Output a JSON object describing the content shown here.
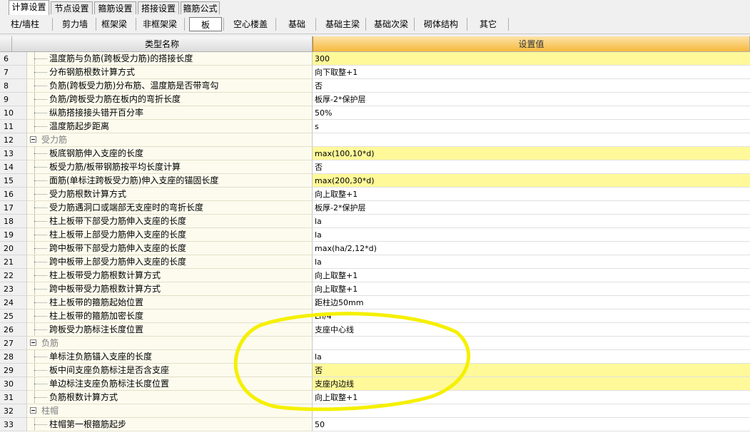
{
  "tabs": [
    {
      "label": "计算设置",
      "active": true
    },
    {
      "label": "节点设置",
      "active": false
    },
    {
      "label": "箍筋设置",
      "active": false
    },
    {
      "label": "搭接设置",
      "active": false
    },
    {
      "label": "箍筋公式",
      "active": false
    }
  ],
  "toolbar": [
    {
      "label": "柱/墙柱",
      "selected": false
    },
    {
      "label": "剪力墙",
      "selected": false
    },
    {
      "label": "框架梁",
      "selected": false
    },
    {
      "label": "非框架梁",
      "selected": false
    },
    {
      "label": "板",
      "selected": true
    },
    {
      "label": "空心楼盖",
      "selected": false
    },
    {
      "label": "基础",
      "selected": false
    },
    {
      "label": "基础主梁",
      "selected": false
    },
    {
      "label": "基础次梁",
      "selected": false
    },
    {
      "label": "砌体结构",
      "selected": false
    },
    {
      "label": "其它",
      "selected": false
    }
  ],
  "table": {
    "header_name": "类型名称",
    "header_value": "设置值",
    "rows": [
      {
        "num": "6",
        "type": "item",
        "name": "温度筋与负筋(跨板受力筋)的搭接长度",
        "value": "300",
        "highlight": true
      },
      {
        "num": "7",
        "type": "item",
        "name": "分布钢筋根数计算方式",
        "value": "向下取整+1",
        "highlight": false
      },
      {
        "num": "8",
        "type": "item",
        "name": "负筋(跨板受力筋)分布筋、温度筋是否带弯勾",
        "value": "否",
        "highlight": false
      },
      {
        "num": "9",
        "type": "item",
        "name": "负筋/跨板受力筋在板内的弯折长度",
        "value": "板厚-2*保护层",
        "highlight": false
      },
      {
        "num": "10",
        "type": "item",
        "name": "纵筋搭接接头错开百分率",
        "value": "50%",
        "highlight": false
      },
      {
        "num": "11",
        "type": "item",
        "name": "温度筋起步距离",
        "value": "s",
        "highlight": false
      },
      {
        "num": "12",
        "type": "group",
        "name": "受力筋",
        "value": "",
        "highlight": false
      },
      {
        "num": "13",
        "type": "item",
        "name": "板底钢筋伸入支座的长度",
        "value": "max(100,10*d)",
        "highlight": true
      },
      {
        "num": "14",
        "type": "item",
        "name": "板受力筋/板带钢筋按平均长度计算",
        "value": "否",
        "highlight": false
      },
      {
        "num": "15",
        "type": "item",
        "name": "面筋(单标注跨板受力筋)伸入支座的锚固长度",
        "value": "max(200,30*d)",
        "highlight": true
      },
      {
        "num": "16",
        "type": "item",
        "name": "受力筋根数计算方式",
        "value": "向上取整+1",
        "highlight": false
      },
      {
        "num": "17",
        "type": "item",
        "name": "受力筋遇洞口或端部无支座时的弯折长度",
        "value": "板厚-2*保护层",
        "highlight": false
      },
      {
        "num": "18",
        "type": "item",
        "name": "柱上板带下部受力筋伸入支座的长度",
        "value": "la",
        "highlight": false
      },
      {
        "num": "19",
        "type": "item",
        "name": "柱上板带上部受力筋伸入支座的长度",
        "value": "la",
        "highlight": false
      },
      {
        "num": "20",
        "type": "item",
        "name": "跨中板带下部受力筋伸入支座的长度",
        "value": "max(ha/2,12*d)",
        "highlight": false
      },
      {
        "num": "21",
        "type": "item",
        "name": "跨中板带上部受力筋伸入支座的长度",
        "value": "la",
        "highlight": false
      },
      {
        "num": "22",
        "type": "item",
        "name": "柱上板带受力筋根数计算方式",
        "value": "向上取整+1",
        "highlight": false
      },
      {
        "num": "23",
        "type": "item",
        "name": "跨中板带受力筋根数计算方式",
        "value": "向上取整+1",
        "highlight": false
      },
      {
        "num": "24",
        "type": "item",
        "name": "柱上板带的箍筋起始位置",
        "value": "距柱边50mm",
        "highlight": false
      },
      {
        "num": "25",
        "type": "item",
        "name": "柱上板带的箍筋加密长度",
        "value": "Ln/4",
        "highlight": false
      },
      {
        "num": "26",
        "type": "item",
        "name": "跨板受力筋标注长度位置",
        "value": "支座中心线",
        "highlight": false
      },
      {
        "num": "27",
        "type": "group",
        "name": "负筋",
        "value": "",
        "highlight": false
      },
      {
        "num": "28",
        "type": "item",
        "name": "单标注负筋锚入支座的长度",
        "value": "la",
        "highlight": false
      },
      {
        "num": "29",
        "type": "item",
        "name": "板中间支座负筋标注是否含支座",
        "value": "否",
        "highlight": true
      },
      {
        "num": "30",
        "type": "item",
        "name": "单边标注支座负筋标注长度位置",
        "value": "支座内边线",
        "highlight": true
      },
      {
        "num": "31",
        "type": "item",
        "name": "负筋根数计算方式",
        "value": "向上取整+1",
        "highlight": false
      },
      {
        "num": "32",
        "type": "group",
        "name": "柱帽",
        "value": "",
        "highlight": false
      },
      {
        "num": "33",
        "type": "item",
        "name": "柱帽第一根箍筋起步",
        "value": "50",
        "highlight": false
      }
    ]
  },
  "colors": {
    "highlight_row": "#fff99a",
    "header_value_bg": "#f6b93f",
    "annotation": "#f5f000"
  },
  "icons": {
    "group_toggle": "minus-box-icon"
  }
}
